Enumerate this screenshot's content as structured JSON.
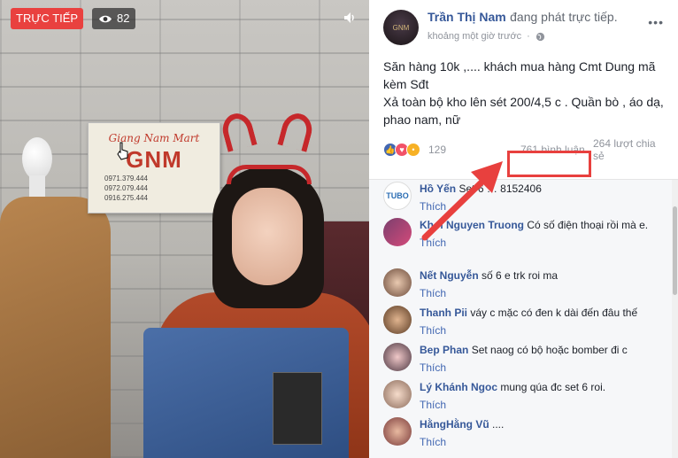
{
  "video": {
    "live_label": "TRỰC TIẾP",
    "viewer_count": "82",
    "sign": {
      "script": "Giang Nam Mart",
      "big": "GNM",
      "phones": [
        "0971.379.444",
        "0972.079.444",
        "0916.275.444"
      ]
    }
  },
  "post": {
    "author": "Trần Thị Nam",
    "action": "đang phát trực tiếp.",
    "time": "khoảng một giờ trước",
    "line1": "Săn hàng 10k ,.... khách mua hàng Cmt Dung mã kèm Sđt",
    "line2": "Xả toàn bộ kho lên sét 200/4,5 c . Quần bò , áo dạ, phao nam, nữ",
    "reactions": "129",
    "comments": "761 bình luận",
    "shares": "264 lượt chia sẻ"
  },
  "comments": [
    {
      "name": "Hồ Yến",
      "text": "Set 6 … 8152406",
      "like": "Thích"
    },
    {
      "name": "Khoi Nguyen Truong",
      "text": "Có số điện thoại rồi mà e.",
      "like": "Thích"
    },
    {
      "name": "Nết Nguyễn",
      "text": "số 6 e trk roi ma",
      "like": "Thích"
    },
    {
      "name": "Thanh Pii",
      "text": "váy c mặc có đen k dài đến đâu thế",
      "like": "Thích"
    },
    {
      "name": "Bep Phan",
      "text": "Set naog có bộ hoặc bomber đi c",
      "like": "Thích"
    },
    {
      "name": "Lý Khánh Ngoc",
      "text": "mung qúa đc set 6 roi.",
      "like": "Thích"
    },
    {
      "name": "HằngHằng Vũ",
      "text": "....",
      "like": "Thích"
    }
  ],
  "colors": {
    "live_red": "#e9413f",
    "link_blue": "#365899",
    "highlight_red": "#e8403e"
  },
  "icons": [
    "eye-icon",
    "volume-icon",
    "more-icon",
    "globe-icon",
    "like-icon",
    "love-icon",
    "wow-icon",
    "cursor-icon",
    "arrow-icon"
  ]
}
